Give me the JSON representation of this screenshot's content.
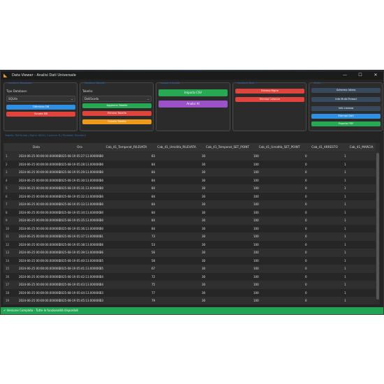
{
  "window": {
    "title": "Data Viewer - Analisi Dati Universale",
    "controls": [
      "—",
      "☐",
      "✕"
    ]
  },
  "db_group": {
    "title": "Gestione Database",
    "type_label": "Tipo Database:",
    "type_value": "SQLite",
    "optimize_label": "Ottimizza DB",
    "empty_label": "Svuota DB"
  },
  "table_group": {
    "title": "Gestione Tabelle",
    "table_label": "Tabella:",
    "table_value": "DatiScoda",
    "refresh_label": "Aggiorna Tabelle",
    "delete_label": "Elimina Tabella",
    "empty_label": "Svuota Tabella"
  },
  "import_group": {
    "title": "Import e Analisi",
    "import_label": "Importa CSV",
    "ai_label": "Analisi AI"
  },
  "data_group": {
    "title": "Gestione Dati",
    "delete_rows_label": "Elimina Righe",
    "delete_cols_label": "Elimina Colonne"
  },
  "view_group": {
    "title": "Utility",
    "fullscreen_label": "Schermo Intero",
    "multithread_label": "Info Multi-Thread",
    "license_label": "Info Licenza",
    "print_label": "Stampa Dati",
    "pdf_label": "Esporta PDF"
  },
  "table_caption": "Tabella: DatiScoda | Righe: 8640 | Colonne: 8 | Modalità: Standard",
  "columns": [
    "",
    "Data",
    "Ora",
    "Cab_41_Temperat_RILEVATA",
    "Cab_41_Umidità_RILEVATA",
    "Cab_41_Temperat_SET_POINT",
    "Cab_41_Umidità_SET_POINT",
    "Cab_41_ARRESTO",
    "Cab_41_MARCIA"
  ],
  "rows": [
    [
      "1",
      "2024-06-25 00:00:00.000000",
      "2025-08-19 05:27:13.000000",
      "30",
      "83",
      "30",
      "100",
      "0",
      "1"
    ],
    [
      "2",
      "2024-06-25 00:00:00.000000",
      "2025-08-19 05:28:13.000000",
      "30",
      "84",
      "30",
      "100",
      "0",
      "1"
    ],
    [
      "3",
      "2024-06-25 00:00:00.000000",
      "2025-08-19 05:29:13.000000",
      "30",
      "84",
      "30",
      "100",
      "0",
      "1"
    ],
    [
      "4",
      "2024-06-25 00:00:00.000000",
      "2025-08-19 05:30:13.000000",
      "30",
      "84",
      "30",
      "100",
      "0",
      "1"
    ],
    [
      "5",
      "2024-06-25 00:00:00.000000",
      "2025-08-19 05:31:13.000000",
      "30",
      "84",
      "30",
      "100",
      "0",
      "1"
    ],
    [
      "6",
      "2024-06-25 00:00:00.000000",
      "2025-08-19 05:32:13.000000",
      "30",
      "84",
      "30",
      "100",
      "0",
      "1"
    ],
    [
      "7",
      "2024-06-25 00:00:00.000000",
      "2025-08-19 05:33:13.000000",
      "30",
      "84",
      "30",
      "100",
      "0",
      "1"
    ],
    [
      "8",
      "2024-06-25 00:00:00.000000",
      "2025-08-19 05:34:13.000000",
      "30",
      "84",
      "30",
      "100",
      "0",
      "1"
    ],
    [
      "9",
      "2024-06-25 00:00:00.000000",
      "2025-08-19 05:35:13.000000",
      "30",
      "84",
      "30",
      "100",
      "0",
      "1"
    ],
    [
      "10",
      "2024-06-25 00:00:00.000000",
      "2025-08-19 05:36:13.000000",
      "30",
      "84",
      "30",
      "100",
      "0",
      "1"
    ],
    [
      "11",
      "2024-06-25 00:00:00.000000",
      "2025-08-19 05:37:13.000000",
      "31",
      "73",
      "30",
      "100",
      "0",
      "1"
    ],
    [
      "12",
      "2024-06-25 00:00:00.000000",
      "2025-08-19 05:38:13.000000",
      "36",
      "53",
      "30",
      "100",
      "0",
      "1"
    ],
    [
      "13",
      "2024-06-25 00:00:00.000000",
      "2025-08-19 05:39:13.000000",
      "36",
      "56",
      "30",
      "100",
      "0",
      "1"
    ],
    [
      "14",
      "2024-06-25 00:00:00.000000",
      "2025-08-19 05:40:13.000000",
      "35",
      "58",
      "30",
      "100",
      "0",
      "1"
    ],
    [
      "15",
      "2024-06-25 00:00:00.000000",
      "2025-08-19 05:41:13.000000",
      "35",
      "67",
      "30",
      "100",
      "0",
      "1"
    ],
    [
      "16",
      "2024-06-25 00:00:00.000000",
      "2025-08-19 05:42:13.000000",
      "34",
      "72",
      "30",
      "100",
      "0",
      "1"
    ],
    [
      "17",
      "2024-06-25 00:00:00.000000",
      "2025-08-19 05:43:13.000000",
      "34",
      "75",
      "30",
      "100",
      "0",
      "1"
    ],
    [
      "18",
      "2024-06-25 00:00:00.000000",
      "2025-08-19 05:44:13.000000",
      "33",
      "77",
      "30",
      "100",
      "0",
      "1"
    ],
    [
      "19",
      "2024-06-25 00:00:00.000000",
      "2025-08-19 05:45:13.000000",
      "33",
      "79",
      "30",
      "100",
      "0",
      "1"
    ]
  ],
  "status": "Versione Completa - Tutte le funzionalità disponibili",
  "colors": {
    "blue": "#2f8fe0",
    "red": "#e0443c",
    "green": "#27a853",
    "orange": "#ee9a1a",
    "purple": "#9a52c6",
    "dark": "#3a4a5e"
  }
}
